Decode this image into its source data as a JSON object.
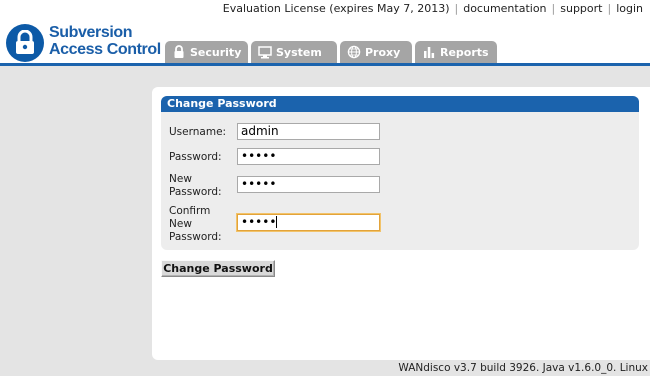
{
  "app": {
    "logo_line1": "Subversion",
    "logo_line2": "Access Control",
    "brand_color": "#1b63ad"
  },
  "toplinks": {
    "license": "Evaluation License (expires May 7, 2013)",
    "documentation": "documentation",
    "support": "support",
    "login": "login"
  },
  "tabs": [
    {
      "label": "Security",
      "icon": "lock-icon"
    },
    {
      "label": "System",
      "icon": "monitor-icon"
    },
    {
      "label": "Proxy",
      "icon": "globe-icon"
    },
    {
      "label": "Reports",
      "icon": "bar-chart-icon"
    }
  ],
  "panel": {
    "title": "Change Password"
  },
  "form": {
    "username_label": "Username:",
    "username_value": "admin",
    "password_label": "Password:",
    "password_value": "•••••",
    "new_password_label_1": "New",
    "new_password_label_2": "Password:",
    "new_password_value": "•••••",
    "confirm_label_1": "Confirm",
    "confirm_label_2": "New",
    "confirm_label_3": "Password:",
    "confirm_value": "•••••"
  },
  "button": {
    "submit_label": "Change Password"
  },
  "footer": {
    "version": "WANdisco v3.7 build 3926. Java v1.6.0_0. Linux"
  }
}
